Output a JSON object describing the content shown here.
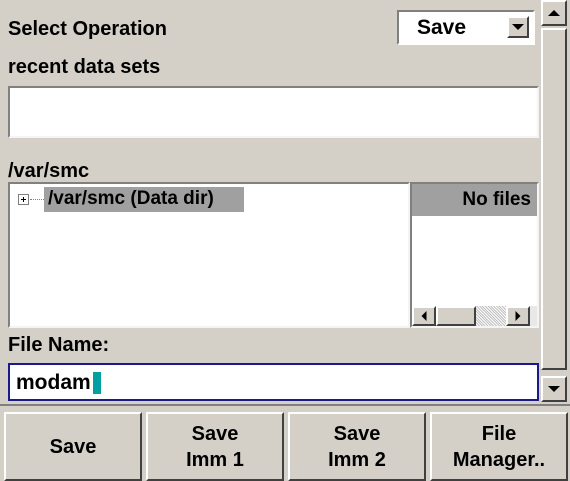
{
  "panel": {
    "select_operation_label": "Select Operation",
    "operation_value": "Save",
    "recent_label": "recent data sets",
    "recent_value": "",
    "path_label": "/var/smc",
    "tree_node_label": "/var/smc (Data dir)",
    "file_list_header": "No files",
    "file_name_label": "File Name:",
    "file_name_value": "modam"
  },
  "softkeys": [
    {
      "label": "Save"
    },
    {
      "label": "Save\nImm 1"
    },
    {
      "label": "Save\nImm 2"
    },
    {
      "label": "File\nManager.."
    }
  ],
  "colors": {
    "background": "#d4d0c8",
    "selection": "#a0a0a0",
    "focus_border": "#1a1a8c",
    "caret": "#00a0a0"
  },
  "icons": {
    "expand": "plus-box-icon",
    "dropdown": "chevron-down-icon",
    "scroll_up": "arrow-up-icon",
    "scroll_down": "arrow-down-icon",
    "scroll_left": "arrow-left-icon",
    "scroll_right": "arrow-right-icon"
  }
}
